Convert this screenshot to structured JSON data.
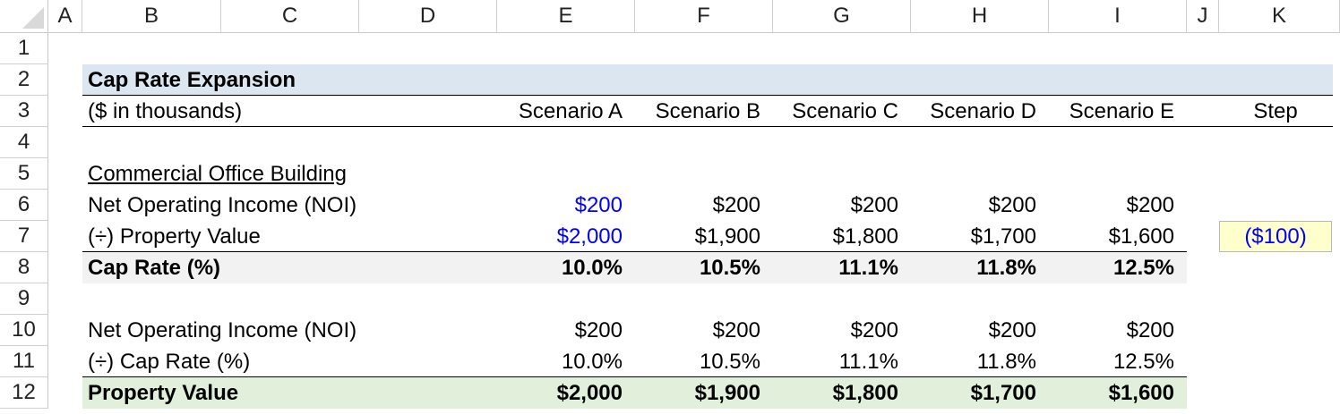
{
  "columns": [
    "A",
    "B",
    "C",
    "D",
    "E",
    "F",
    "G",
    "H",
    "I",
    "J",
    "K"
  ],
  "rows": [
    "1",
    "2",
    "3",
    "4",
    "5",
    "6",
    "7",
    "8",
    "9",
    "10",
    "11",
    "12"
  ],
  "title": "Cap Rate Expansion",
  "units": "($ in thousands)",
  "scenarios": [
    "Scenario A",
    "Scenario B",
    "Scenario C",
    "Scenario D",
    "Scenario E"
  ],
  "step_label": "Step",
  "section_label": "Commercial Office Building",
  "noi_label": "Net Operating Income (NOI)",
  "noi_values": [
    "$200",
    "$200",
    "$200",
    "$200",
    "$200"
  ],
  "property_value_label": "(÷) Property Value",
  "property_values": [
    "$2,000",
    "$1,900",
    "$1,800",
    "$1,700",
    "$1,600"
  ],
  "step_value": "($100)",
  "cap_rate_label": "Cap Rate (%)",
  "cap_rates": [
    "10.0%",
    "10.5%",
    "11.1%",
    "11.8%",
    "12.5%"
  ],
  "noi2_label": "Net Operating Income (NOI)",
  "noi2_values": [
    "$200",
    "$200",
    "$200",
    "$200",
    "$200"
  ],
  "cap_rate2_label": "(÷) Cap Rate (%)",
  "cap_rates2": [
    "10.0%",
    "10.5%",
    "11.1%",
    "11.8%",
    "12.5%"
  ],
  "property_value_total_label": "Property Value",
  "property_value_totals": [
    "$2,000",
    "$1,900",
    "$1,800",
    "$1,700",
    "$1,600"
  ],
  "colors": {
    "title_band": "#dce6f1",
    "cap_rate_band": "#f2f2f2",
    "total_band": "#e2efda",
    "input_blue": "#0000ff",
    "step_fill": "#ffffcc"
  }
}
